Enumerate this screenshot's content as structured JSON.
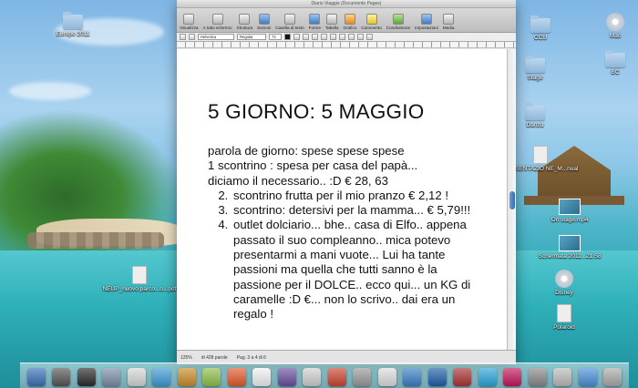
{
  "window": {
    "title": "Diario Viaggio (Documento Pages)",
    "toolbar": [
      {
        "label": "Visualizza",
        "icon": "view-icon"
      },
      {
        "label": "A tutto schermo",
        "icon": "fullscreen-icon"
      },
      {
        "label": "Struttura",
        "icon": "outline-icon"
      },
      {
        "label": "Sezioni",
        "icon": "sections-icon"
      },
      {
        "label": "Casella di testo",
        "icon": "textbox-icon"
      },
      {
        "label": "Forme",
        "icon": "shapes-icon"
      },
      {
        "label": "Tabella",
        "icon": "table-icon"
      },
      {
        "label": "Grafico",
        "icon": "chart-icon"
      },
      {
        "label": "Commento",
        "icon": "comment-icon"
      },
      {
        "label": "Condivisione",
        "icon": "share-icon"
      },
      {
        "label": "Impostazioni",
        "icon": "inspector-icon"
      },
      {
        "label": "Media",
        "icon": "media-icon"
      }
    ],
    "format": {
      "font": "Helvetica",
      "style": "Regular",
      "size": "72"
    },
    "status": {
      "zoom": "125%",
      "words": "di 428 parole",
      "page": "Pag. 3 a 4 di 6"
    }
  },
  "document": {
    "title": "5 GIORNO: 5 MAGGIO",
    "lines": [
      "parola de giorno: spese spese spese",
      "1 scontrino : spesa per casa del papà...",
      "diciamo il necessario.. :D € 28, 63"
    ],
    "list": [
      "scontrino frutta per il mio pranzo € 2,12 !",
      "scontrino: detersivi per la mamma... € 5,79!!!",
      "outlet dolciario... bhe.. casa di Elfo.. appena passato il suo compleanno.. mica potevo presentarmi a mani vuote... Lui ha tante passioni ma quella che tutti sanno è la passione per il DOLCE.. ecco qui... un KG di caramelle :D €... non lo scrivo.. dai era un regalo !"
    ]
  },
  "desktop": {
    "icons_left": [
      {
        "label": "Europe 2011",
        "type": "folder"
      },
      {
        "label": "NEUP_nuovo parco...o...pdf",
        "type": "file"
      }
    ],
    "icons_right": [
      {
        "label": "Mac",
        "type": "drive"
      },
      {
        "label": "CCU",
        "type": "folder"
      },
      {
        "label": "BC",
        "type": "folder"
      },
      {
        "label": "Stage",
        "type": "folder"
      },
      {
        "label": "Danza",
        "type": "folder"
      },
      {
        "label": "PRESENTAZIO NE_M...nual",
        "type": "file"
      },
      {
        "label": "On stage.mp4",
        "type": "video"
      },
      {
        "label": "Schermata 2011...21.58",
        "type": "image"
      },
      {
        "label": "Disney",
        "type": "disk"
      },
      {
        "label": "Polaroid",
        "type": "file"
      }
    ]
  },
  "dock": {
    "apps": 24
  }
}
